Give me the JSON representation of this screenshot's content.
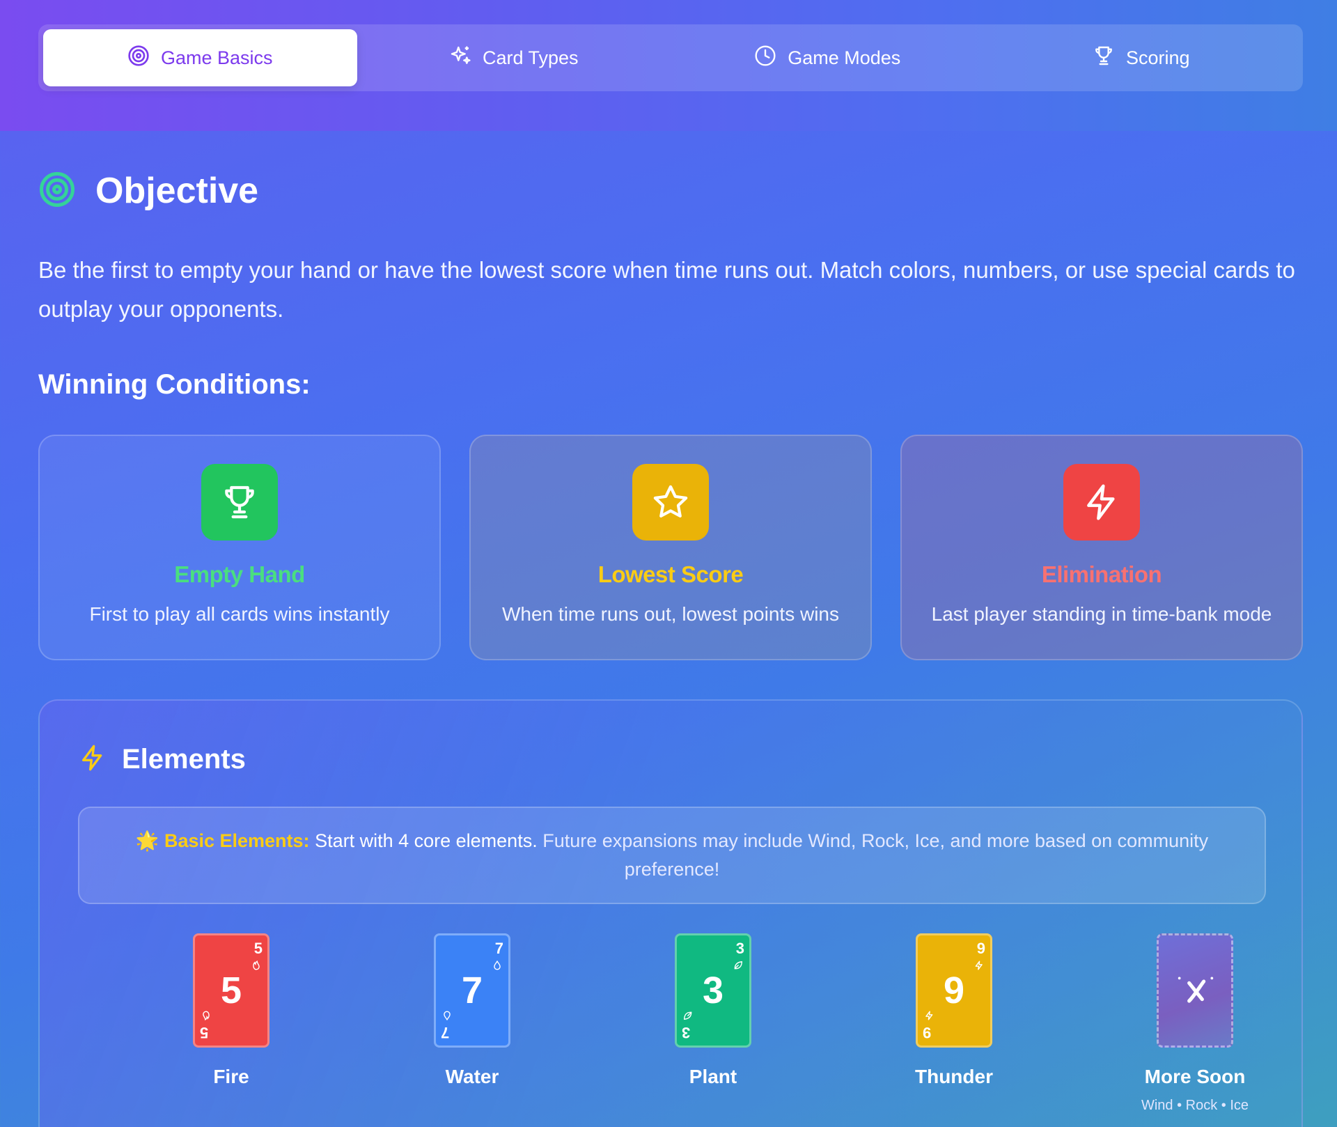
{
  "tabs": [
    {
      "label": "Game Basics",
      "icon": "target-icon",
      "active": true
    },
    {
      "label": "Card Types",
      "icon": "sparkles-icon",
      "active": false
    },
    {
      "label": "Game Modes",
      "icon": "clock-icon",
      "active": false
    },
    {
      "label": "Scoring",
      "icon": "trophy-icon",
      "active": false
    }
  ],
  "objective": {
    "title": "Objective",
    "text": "Be the first to empty your hand or have the lowest score when time runs out. Match colors, numbers, or use special cards to outplay your opponents."
  },
  "winning": {
    "title": "Winning Conditions:",
    "cards": [
      {
        "title": "Empty Hand",
        "desc": "First to play all cards wins instantly",
        "icon": "trophy-icon",
        "color": "#22c55e"
      },
      {
        "title": "Lowest Score",
        "desc": "When time runs out, lowest points wins",
        "icon": "star-icon",
        "color": "#eab308"
      },
      {
        "title": "Elimination",
        "desc": "Last player standing in time-bank mode",
        "icon": "lightning-icon",
        "color": "#ef4444"
      }
    ]
  },
  "elements": {
    "title": "Elements",
    "note_emoji": "🌟",
    "note_highlight": "Basic Elements:",
    "note_main": "Start with 4 core elements.",
    "note_sub": "Future expansions may include Wind, Rock, Ice, and more based on community preference!",
    "items": [
      {
        "name": "Fire",
        "value": "5",
        "color": "#ef4444",
        "icon": "flame-icon"
      },
      {
        "name": "Water",
        "value": "7",
        "color": "#3b82f6",
        "icon": "droplet-icon"
      },
      {
        "name": "Plant",
        "value": "3",
        "color": "#10b981",
        "icon": "leaf-icon"
      },
      {
        "name": "Thunder",
        "value": "9",
        "color": "#eab308",
        "icon": "lightning-icon"
      }
    ],
    "more": {
      "name": "More Soon",
      "sub": "Wind • Rock • Ice",
      "icon": "sparkle-x-icon"
    }
  },
  "colors": {
    "accent": "#7c3aed",
    "target_green": "#34d399",
    "highlight_yellow": "#facc15"
  }
}
